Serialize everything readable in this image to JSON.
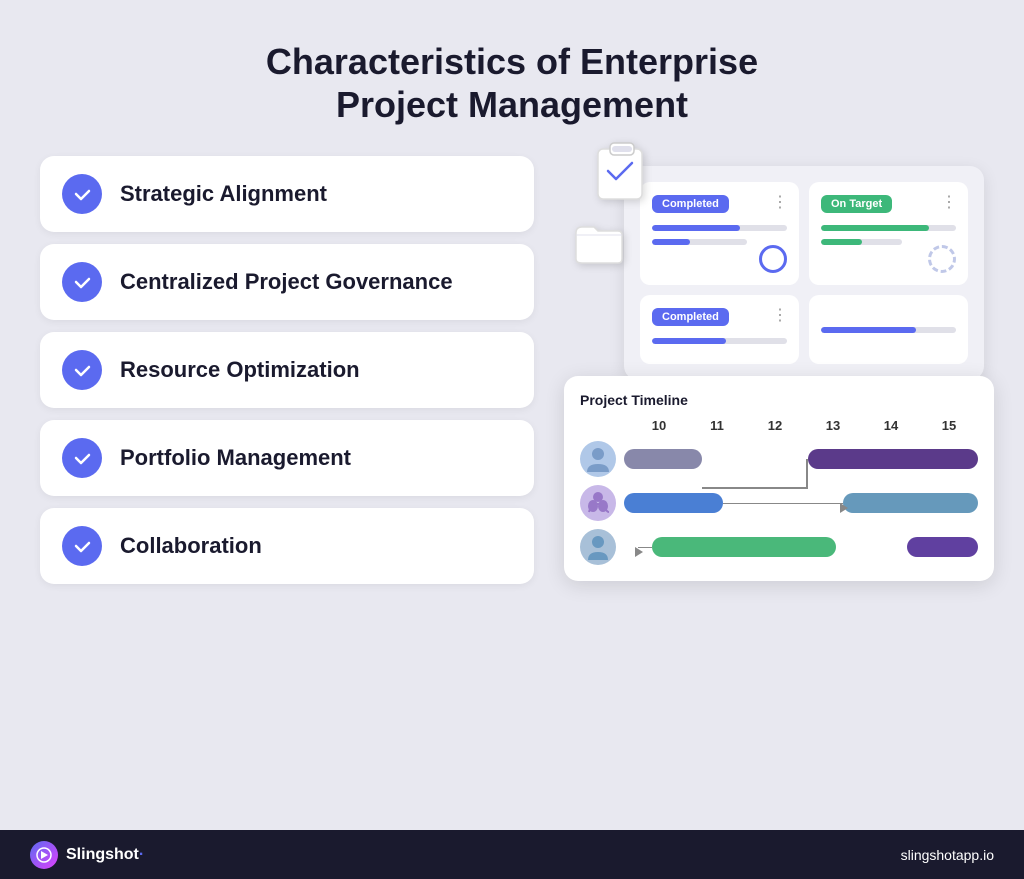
{
  "page": {
    "title_line1": "Characteristics of Enterprise",
    "title_line2": "Project Management",
    "background_color": "#e8e8f0"
  },
  "list_items": [
    {
      "id": "strategic-alignment",
      "label": "Strategic Alignment"
    },
    {
      "id": "centralized-governance",
      "label": "Centralized Project Governance"
    },
    {
      "id": "resource-optimization",
      "label": "Resource Optimization"
    },
    {
      "id": "portfolio-management",
      "label": "Portfolio Management"
    },
    {
      "id": "collaboration",
      "label": "Collaboration"
    }
  ],
  "status_cards": [
    {
      "badge": "Completed",
      "badge_class": "badge-completed",
      "fill_class": "fill-blue",
      "circle_class": "circle-blue"
    },
    {
      "badge": "On Target",
      "badge_class": "badge-ontarget",
      "fill_class": "fill-green",
      "circle_class": "circle-gray"
    },
    {
      "badge": "Completed",
      "badge_class": "badge-completed",
      "fill_class": "fill-blue2",
      "circle_class": "circle-blue"
    }
  ],
  "timeline": {
    "title": "Project Timeline",
    "headers": [
      "10",
      "11",
      "12",
      "13",
      "14",
      "15"
    ],
    "rows": [
      {
        "avatar_color": "#a0b8d8",
        "person": "person1"
      },
      {
        "avatar_color": "#b8a8d8",
        "person": "person2"
      },
      {
        "avatar_color": "#90b0d0",
        "person": "person3"
      }
    ]
  },
  "footer": {
    "brand_name": "Slingshot",
    "url": "slingshotapp.io"
  }
}
